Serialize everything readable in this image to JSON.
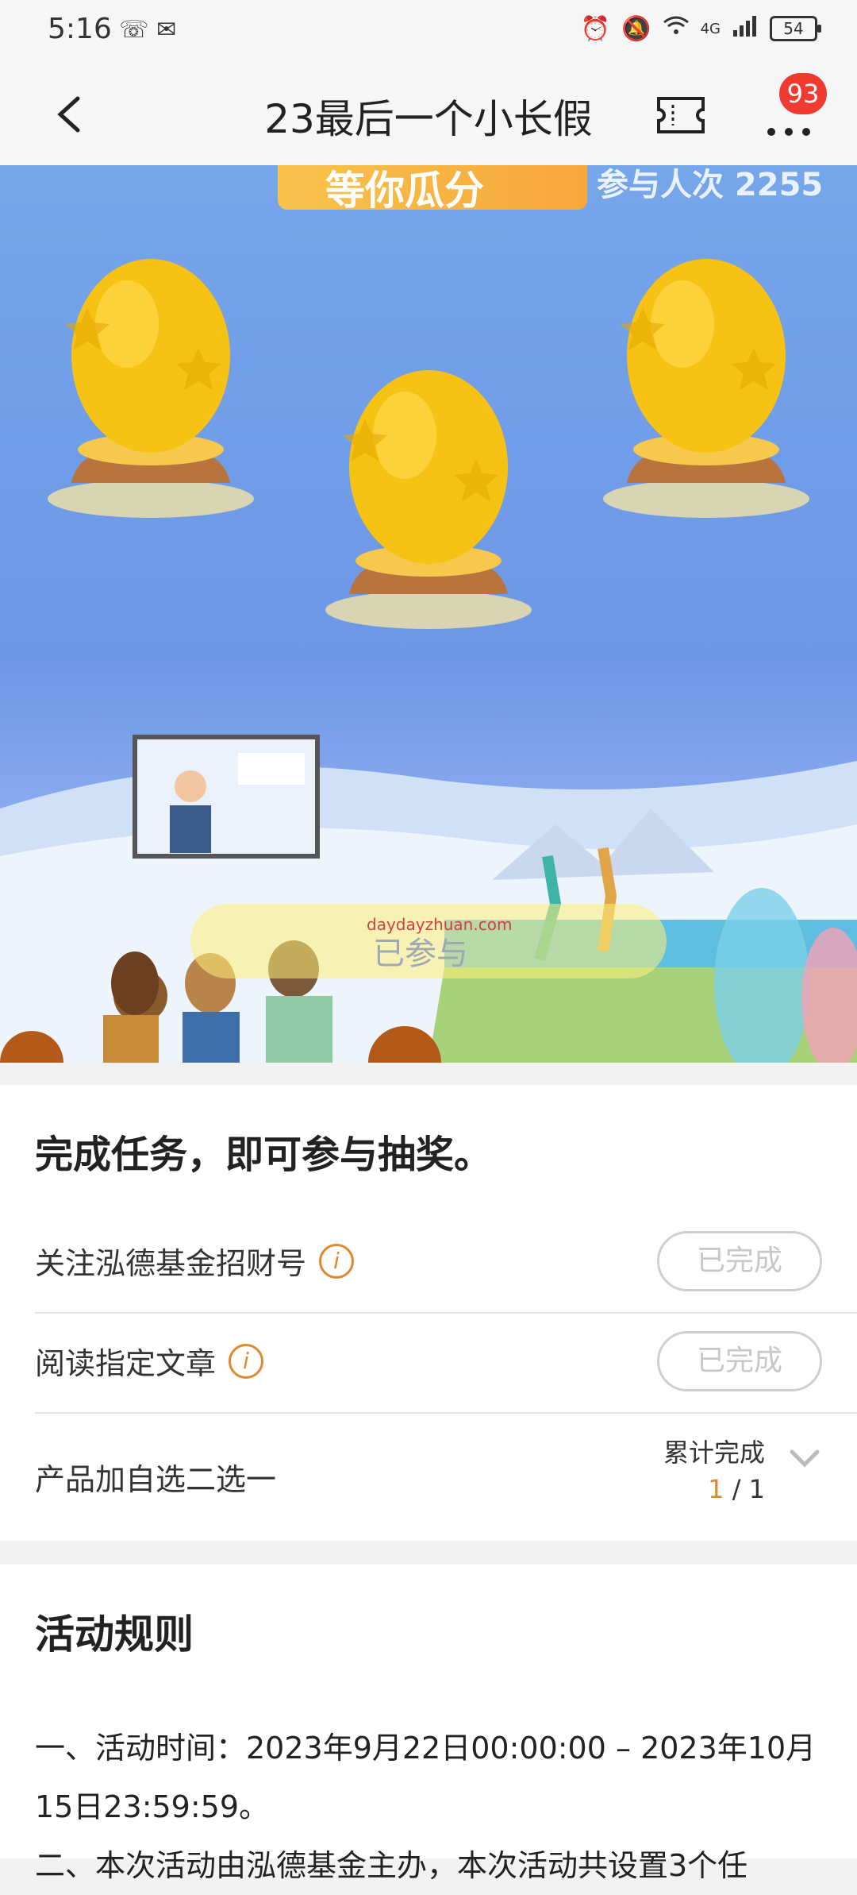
{
  "status_bar": {
    "time": "5:16",
    "left_icons": [
      "missed-call-icon",
      "wechat-icon"
    ],
    "right_icons": [
      "alarm-icon",
      "mute-icon",
      "wifi-icon",
      "signal-icon"
    ],
    "network": "4G",
    "battery": "54"
  },
  "app_bar": {
    "title": "23最后一个小长假",
    "badge": "93"
  },
  "banner": {
    "strip_text": "等你瓜分",
    "participants": "参与人次 2255",
    "done_overlay": "已参与",
    "watermark": "daydayzhuan.com"
  },
  "tasks": {
    "title": "完成任务，即可参与抽奖。",
    "items": [
      {
        "label": "关注泓德基金招财号",
        "status": "已完成"
      },
      {
        "label": "阅读指定文章",
        "status": "已完成"
      },
      {
        "label": "产品加自选二选一",
        "accum_label": "累计完成",
        "done": "1",
        "total": " / 1"
      }
    ]
  },
  "rules": {
    "title": "活动规则",
    "text": "一、活动时间：2023年9月22日00:00:00 – 2023年10月15日23:59:59。",
    "text2": "二、本次活动由泓德基金主办，本次活动共设置3个任"
  },
  "colors": {
    "accent": "#e0882f",
    "badge": "#f23b30",
    "banner": "#6d97e6"
  }
}
